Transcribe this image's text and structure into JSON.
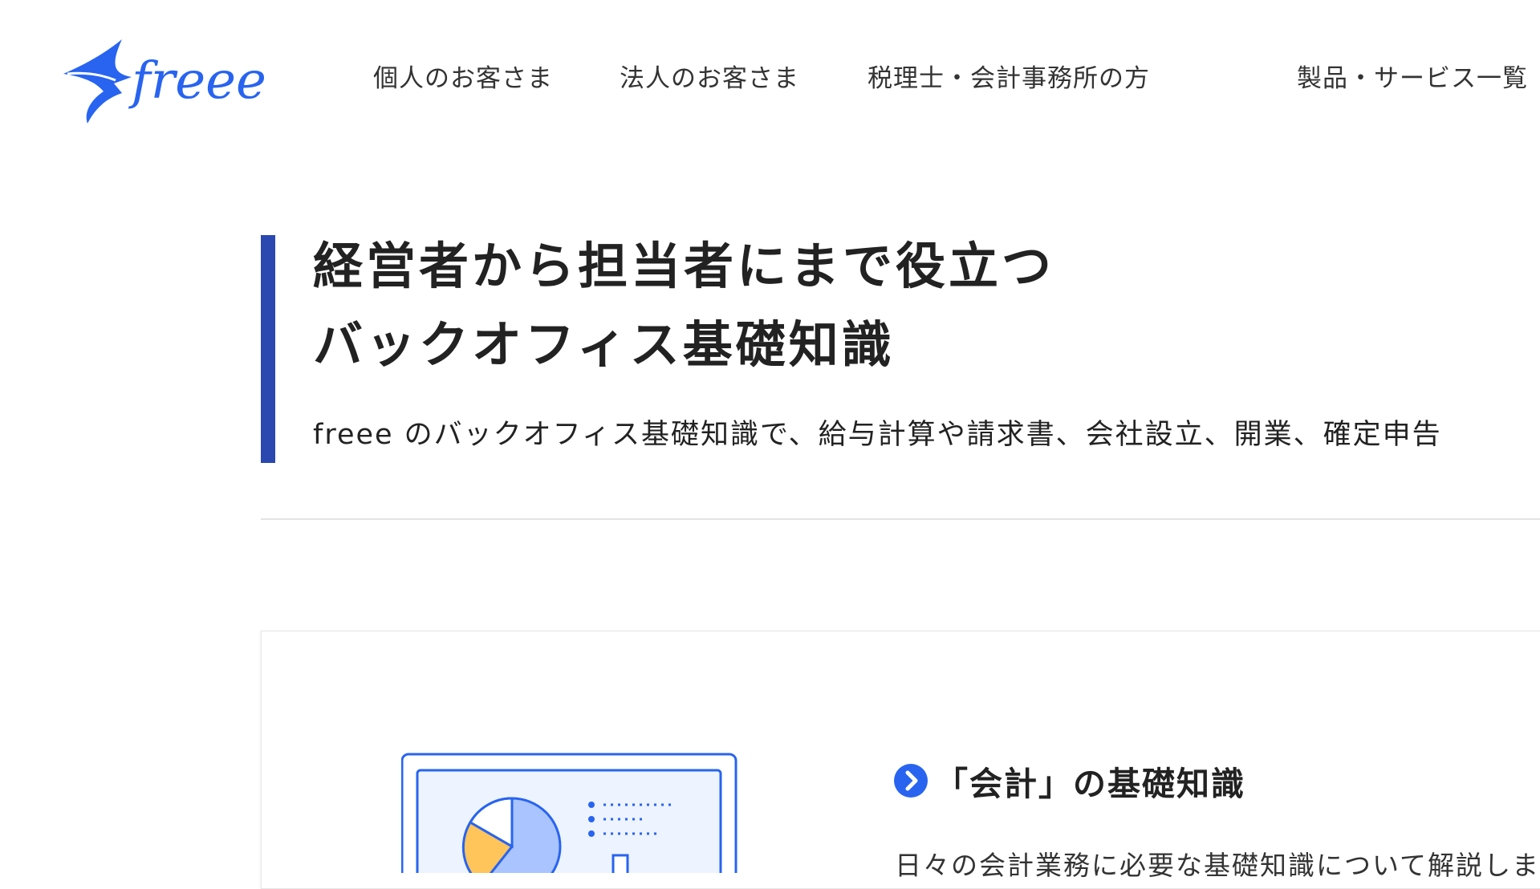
{
  "header": {
    "logo_text": "freee",
    "nav": [
      {
        "label": "個人のお客さま"
      },
      {
        "label": "法人のお客さま"
      },
      {
        "label": "税理士・会計事務所の方"
      },
      {
        "label": "製品・サービス一覧"
      }
    ]
  },
  "hero": {
    "title_line1": "経営者から担当者にまで役立つ",
    "title_line2": "バックオフィス基礎知識",
    "description": "freee のバックオフィス基礎知識で、給与計算や請求書、会社設立、開業、確定申告"
  },
  "card": {
    "title": "「会計」の基礎知識",
    "description": "日々の会計業務に必要な基礎知識について解説しま"
  },
  "colors": {
    "brand_blue": "#2864f0",
    "accent_navy": "#2b47b0",
    "chart_light_blue": "#aac4ff",
    "chart_orange": "#ffc45a"
  },
  "icons": {
    "logo": "freee-bird-logo",
    "card_title_icon": "chevron-right-circle-icon"
  }
}
